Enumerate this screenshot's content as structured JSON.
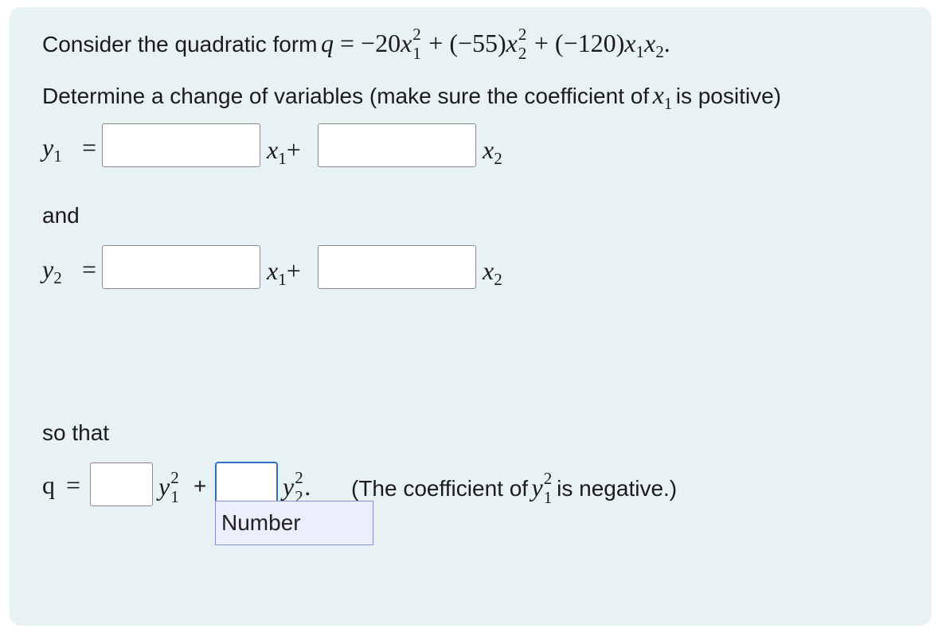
{
  "question": {
    "intro": "Consider the quadratic form",
    "form_lhs": "q",
    "coef1": "−20",
    "coef2": "(−55)",
    "coef3": "(−120)",
    "instruction_pre": "Determine a change of variables (make sure the coefficient of",
    "instruction_post": "is positive)",
    "and_label": "and",
    "so_that_label": "so that",
    "note_pre": "(The coefficient of",
    "note_post": "is negative.)"
  },
  "symbols": {
    "equals": "=",
    "plus": "+",
    "x": "x",
    "y": "y",
    "q": "q",
    "sub1": "1",
    "sub2": "2",
    "sup2": "2",
    "period": "."
  },
  "inputs": {
    "y1_x1_coef": "",
    "y1_x2_coef": "",
    "y2_x1_coef": "",
    "y2_x2_coef": "",
    "q_y1_coef": "",
    "q_y2_coef": ""
  },
  "tooltip": {
    "text": "Number"
  },
  "colors": {
    "panel_bg": "#e8f2f4",
    "focus_border": "#2f6fc9",
    "tooltip_bg": "#eceefd"
  }
}
